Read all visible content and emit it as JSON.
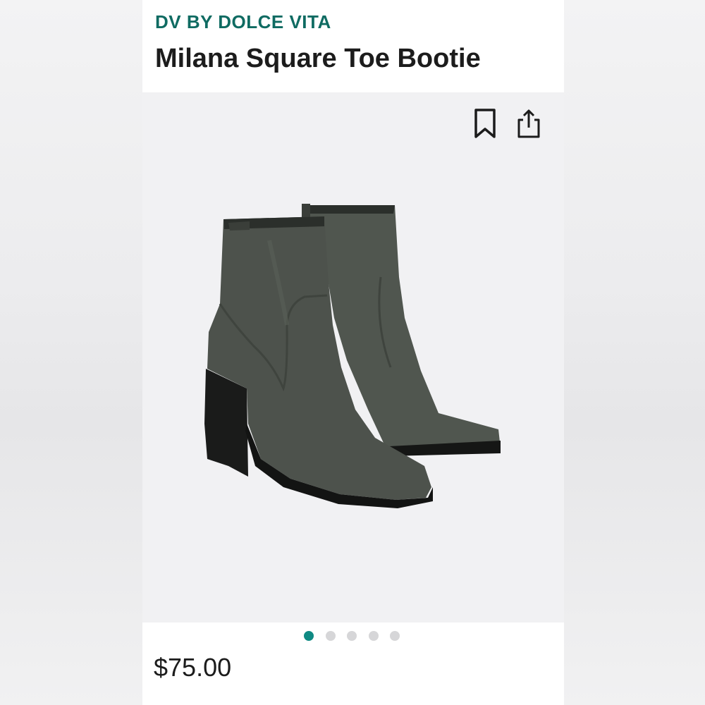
{
  "product": {
    "brand": "DV BY DOLCE VITA",
    "title": "Milana Square Toe Bootie",
    "price": "$75.00"
  },
  "gallery": {
    "image_subject": "pair of dark olive-grey square toe ankle booties",
    "total_images": 5,
    "active_index": 0
  },
  "icons": {
    "bookmark": "bookmark-icon",
    "share": "share-icon"
  },
  "colors": {
    "brand_accent": "#0f6b62",
    "active_dot": "#0f8a83",
    "inactive_dot": "#d6d6d8",
    "boot_leather": "#4d524c"
  }
}
